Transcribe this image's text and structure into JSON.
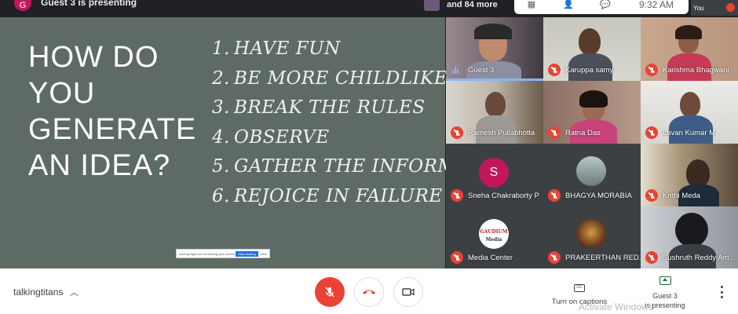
{
  "topbar": {
    "presenter_initial": "G",
    "presenter_text": "Guest 3 is presenting",
    "others_text": "and 84 more",
    "time": "9:32 AM",
    "self_label": "You"
  },
  "slide": {
    "title_lines": [
      "HOW DO",
      "YOU",
      "GENERATE",
      "AN IDEA?"
    ],
    "list": [
      {
        "num": "1.",
        "text": "HAVE FUN"
      },
      {
        "num": "2.",
        "text": "BE MORE CHILDLIKE"
      },
      {
        "num": "3.",
        "text": "BREAK THE RULES"
      },
      {
        "num": "4.",
        "text": "OBSERVE"
      },
      {
        "num": "5.",
        "text": "GATHER THE INFORMATION"
      },
      {
        "num": "6.",
        "text": "REJOICE IN FAILURE"
      }
    ],
    "share_banner": {
      "text": "meet.google.com is sharing your screen.",
      "stop": "Stop sharing",
      "hide": "Hide"
    }
  },
  "participants": [
    {
      "name": "Guest 3",
      "speaking": true
    },
    {
      "name": "Karuppa samy"
    },
    {
      "name": "Karishma Bhagwani"
    },
    {
      "name": "Ramesh Pullabhotla"
    },
    {
      "name": "Ratna Das"
    },
    {
      "name": "Lavan Kumar M"
    },
    {
      "name": "Sneha Chakraborty P",
      "initial": "S"
    },
    {
      "name": "BHAGYA MORABIA"
    },
    {
      "name": "Krithi Meda"
    },
    {
      "name": "Media Center",
      "logo_line1": "GAUDIUM",
      "logo_line2": "Media"
    },
    {
      "name": "PRAKEERTHAN RED..."
    },
    {
      "name": "Sushruth Reddy Am..."
    }
  ],
  "bottombar": {
    "meeting_name": "talkingtitans",
    "captions_label": "Turn on captions",
    "presenting_label_1": "Guest 3",
    "presenting_label_2": "is presenting",
    "watermark": "Activate Windows"
  },
  "colors": {
    "slide_bg": "#5e6b64",
    "mic_off_red": "#ea4335",
    "accent_green": "#137333",
    "speaking_blue": "#8ab4f8"
  }
}
